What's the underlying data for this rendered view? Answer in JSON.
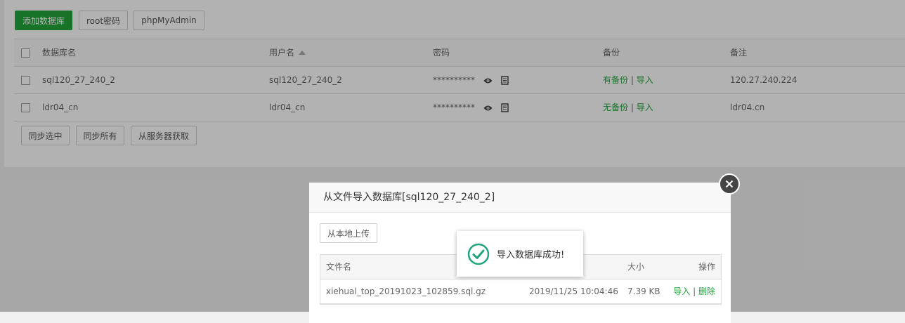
{
  "toolbar": {
    "add_db": "添加数据库",
    "root_pwd": "root密码",
    "phpmyadmin": "phpMyAdmin"
  },
  "db_table": {
    "headers": {
      "name": "数据库名",
      "user": "用户名",
      "password": "密码",
      "backup": "备份",
      "note": "备注"
    },
    "rows": [
      {
        "name": "sql120_27_240_2",
        "user": "sql120_27_240_2",
        "password": "**********",
        "backup": "有备份",
        "sep": "|",
        "import": "导入",
        "note": "120.27.240.224"
      },
      {
        "name": "ldr04_cn",
        "user": "ldr04_cn",
        "password": "**********",
        "backup": "无备份",
        "sep": "|",
        "import": "导入",
        "note": "ldr04.cn"
      }
    ]
  },
  "bottom_buttons": {
    "sync_selected": "同步选中",
    "sync_all": "同步所有",
    "fetch_server": "从服务器获取"
  },
  "dialog": {
    "title": "从文件导入数据库[sql120_27_240_2]",
    "upload_btn": "从本地上传",
    "headers": {
      "filename": "文件名",
      "size": "大小",
      "ops": "操作"
    },
    "files": [
      {
        "name": "xiehual_top_20191023_102859.sql.gz",
        "time": "2019/11/25 10:04:46",
        "size": "7.39 KB",
        "import": "导入",
        "sep": "|",
        "delete": "删除"
      }
    ]
  },
  "toast": {
    "message": "导入数据库成功!"
  },
  "colors": {
    "primary": "#20a53a",
    "toast_check": "#20a580"
  }
}
